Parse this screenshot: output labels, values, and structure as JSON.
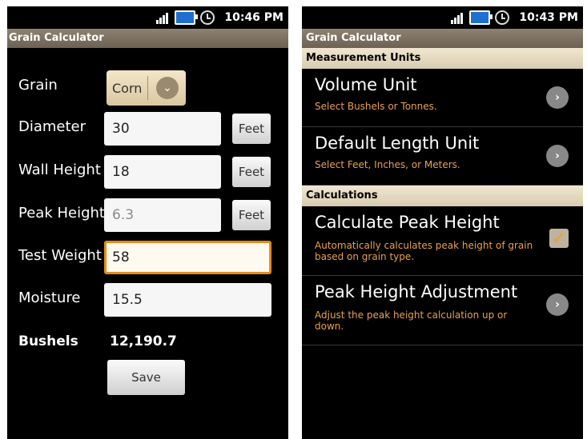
{
  "left": {
    "status": {
      "time": "10:46 PM"
    },
    "app_title": "Grain Calculator",
    "grain": {
      "label": "Grain",
      "value": "Corn"
    },
    "diameter": {
      "label": "Diameter",
      "value": "30",
      "unit": "Feet"
    },
    "wall_height": {
      "label": "Wall Height",
      "value": "18",
      "unit": "Feet"
    },
    "peak_height": {
      "label": "Peak Height",
      "value": "6.3",
      "unit": "Feet"
    },
    "test_weight": {
      "label": "Test Weight",
      "value": "58"
    },
    "moisture": {
      "label": "Moisture",
      "value": "15.5"
    },
    "bushels": {
      "label": "Bushels",
      "value": "12,190.7"
    },
    "save_label": "Save"
  },
  "right": {
    "status": {
      "time": "10:43 PM"
    },
    "app_title": "Grain Calculator",
    "sections": [
      {
        "header": "Measurement Units",
        "items": [
          {
            "title": "Volume Unit",
            "summary": "Select Bushels or Tonnes."
          },
          {
            "title": "Default Length Unit",
            "summary": "Select Feet, Inches, or Meters."
          }
        ]
      },
      {
        "header": "Calculations",
        "items": [
          {
            "title": "Calculate Peak Height",
            "summary": "Automatically calculates peak height of grain based on grain type.",
            "checked": true
          },
          {
            "title": "Peak Height Adjustment",
            "summary": "Adjust the peak height calculation up or down."
          }
        ]
      }
    ]
  },
  "colors": {
    "accent": "#e58a1f",
    "titlebar": "#7a6e5e",
    "summary": "#e8a050"
  }
}
